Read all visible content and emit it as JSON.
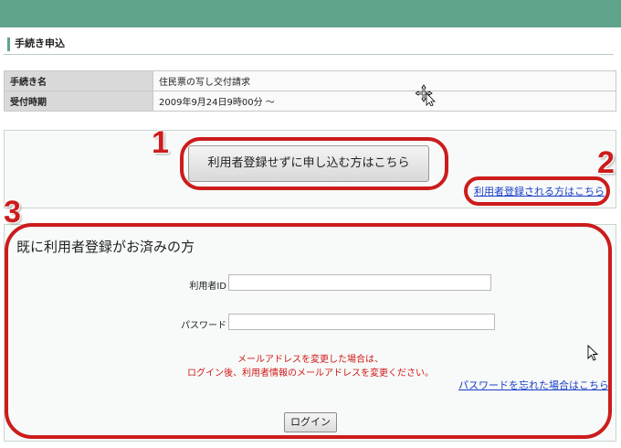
{
  "header": {
    "section_title": "手続き申込"
  },
  "info_table": {
    "rows": [
      {
        "label": "手続き名",
        "value": "住民票の写し交付請求"
      },
      {
        "label": "受付時期",
        "value": "2009年9月24日9時00分 〜"
      }
    ]
  },
  "actions": {
    "no_register_button": "利用者登録せずに申し込む方はこちら",
    "register_link": "利用者登録される方はこちら"
  },
  "login": {
    "heading": "既に利用者登録がお済みの方",
    "user_id_label": "利用者ID",
    "user_id_value": "",
    "password_label": "パスワード",
    "password_value": "",
    "notice_line1": "メールアドレスを変更した場合は、",
    "notice_line2": "ログイン後、利用者情報のメールアドレスを変更ください。",
    "forgot_password_link": "パスワードを忘れた場合はこちら",
    "login_button": "ログイン"
  },
  "annotations": {
    "one": "1",
    "two": "2",
    "three": "3"
  },
  "colors": {
    "header_bar": "#5fa38a",
    "annotation_red": "#cc1c1c",
    "link_blue": "#1a3fc9",
    "notice_red": "#d01818"
  },
  "icons": {
    "move_cursor": "move-cursor-icon",
    "pointer_cursor": "arrow-cursor-icon"
  }
}
